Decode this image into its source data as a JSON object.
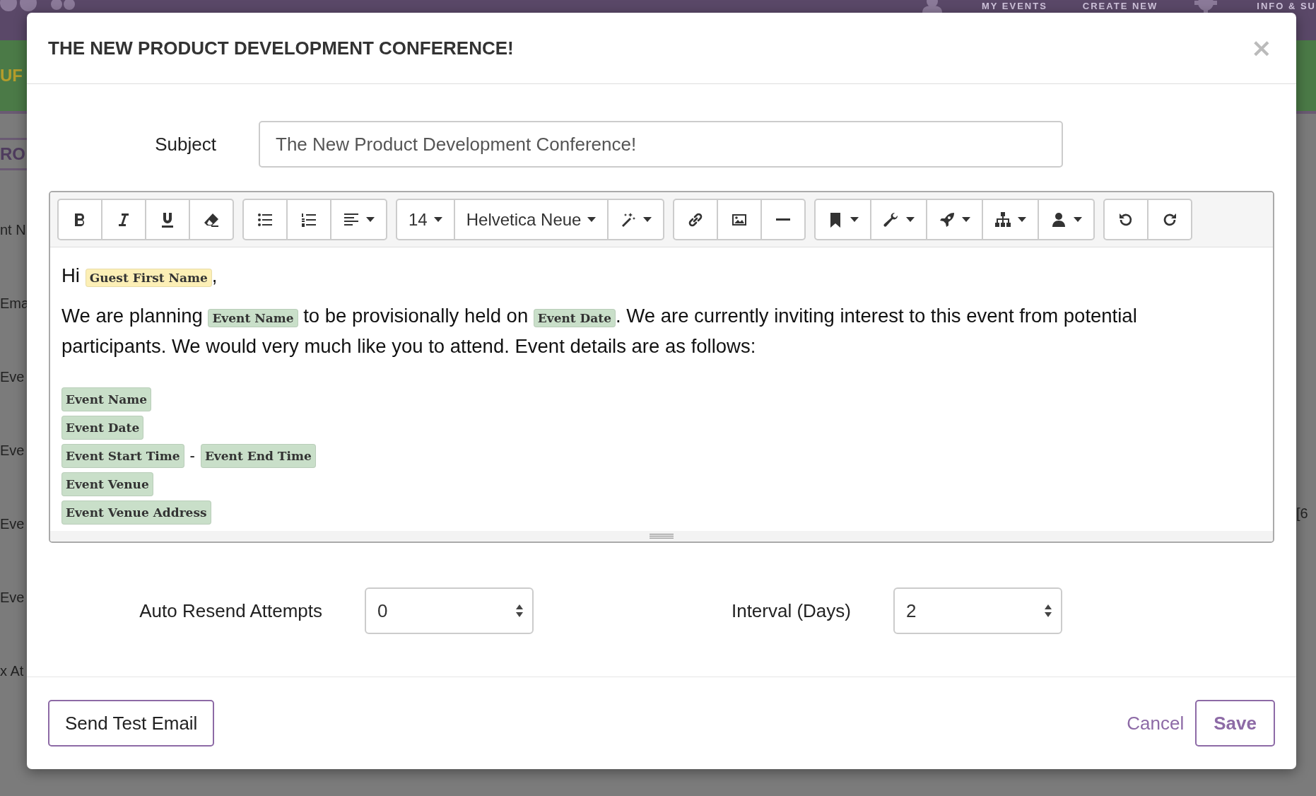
{
  "background": {
    "nav": [
      "MY EVENTS",
      "CREATE NEW",
      "INFO & SU"
    ],
    "banner": "UF",
    "section_heading": "RO",
    "left_fragments": [
      "nt N",
      "Ema",
      "Eve",
      "Eve",
      "Eve",
      "Eve",
      "x At"
    ],
    "right_fragment": "[6"
  },
  "modal": {
    "title": "THE NEW PRODUCT DEVELOPMENT CONFERENCE!",
    "close": "×",
    "subject": {
      "label": "Subject",
      "value": "The New Product Development Conference!"
    },
    "toolbar": [
      [
        {
          "kind": "icon",
          "dropdown": false
        },
        {
          "kind": "icon",
          "dropdown": false
        },
        {
          "kind": "icon",
          "dropdown": false
        },
        {
          "kind": "icon",
          "dropdown": false
        }
      ],
      [
        {
          "kind": "icon",
          "dropdown": false
        },
        {
          "kind": "icon",
          "dropdown": false
        },
        {
          "kind": "icon",
          "dropdown": true
        }
      ],
      [
        {
          "kind": "text",
          "label": "14",
          "dropdown": true
        },
        {
          "kind": "text",
          "label": "Helvetica Neue",
          "dropdown": true
        },
        {
          "kind": "icon",
          "dropdown": true
        }
      ],
      [
        {
          "kind": "icon",
          "dropdown": false
        },
        {
          "kind": "icon",
          "dropdown": false
        },
        {
          "kind": "icon",
          "dropdown": false
        }
      ],
      [
        {
          "kind": "icon",
          "dropdown": true
        },
        {
          "kind": "icon",
          "dropdown": true
        },
        {
          "kind": "icon",
          "dropdown": true
        },
        {
          "kind": "icon",
          "dropdown": true
        },
        {
          "kind": "icon",
          "dropdown": true
        }
      ],
      [
        {
          "kind": "icon",
          "dropdown": false
        },
        {
          "kind": "icon",
          "dropdown": false
        }
      ]
    ],
    "body": [
      {
        "kind": "paragraph",
        "parts": [
          {
            "kind": "text",
            "text": "Hi "
          },
          {
            "kind": "tag",
            "text": "Guest First Name",
            "color": "#fcefb6"
          },
          {
            "kind": "text",
            "text": ","
          }
        ]
      },
      {
        "kind": "paragraph",
        "parts": [
          {
            "kind": "text",
            "text": "We are planning "
          },
          {
            "kind": "tag",
            "text": "Event Name",
            "color": "#c9dfc9"
          },
          {
            "kind": "text",
            "text": " to be provisionally held on "
          },
          {
            "kind": "tag",
            "text": "Event Date",
            "color": "#c9dfc9"
          },
          {
            "kind": "text",
            "text": ". We are currently inviting interest to this event from potential participants. We would very much like you to attend. Event details are as follows:"
          }
        ]
      },
      {
        "kind": "taglines",
        "lines": [
          [
            {
              "kind": "tag",
              "text": "Event Name",
              "color": "#c9dfc9"
            }
          ],
          [
            {
              "kind": "tag",
              "text": "Event Date",
              "color": "#c9dfc9"
            }
          ],
          [
            {
              "kind": "tag",
              "text": "Event Start Time",
              "color": "#c9dfc9"
            },
            {
              "kind": "text",
              "text": "-"
            },
            {
              "kind": "tag",
              "text": "Event End Time",
              "color": "#c9dfc9"
            }
          ],
          [
            {
              "kind": "tag",
              "text": "Event Venue",
              "color": "#c9dfc9"
            }
          ],
          [
            {
              "kind": "tag",
              "text": "Event Venue Address",
              "color": "#c9dfc9"
            }
          ]
        ]
      }
    ],
    "resend": [
      {
        "label": "Auto Resend Attempts",
        "value": "0"
      },
      {
        "label": "Interval (Days)",
        "value": "2"
      }
    ],
    "footer": {
      "test_button": "Send Test Email",
      "cancel": "Cancel",
      "save": "Save"
    }
  }
}
